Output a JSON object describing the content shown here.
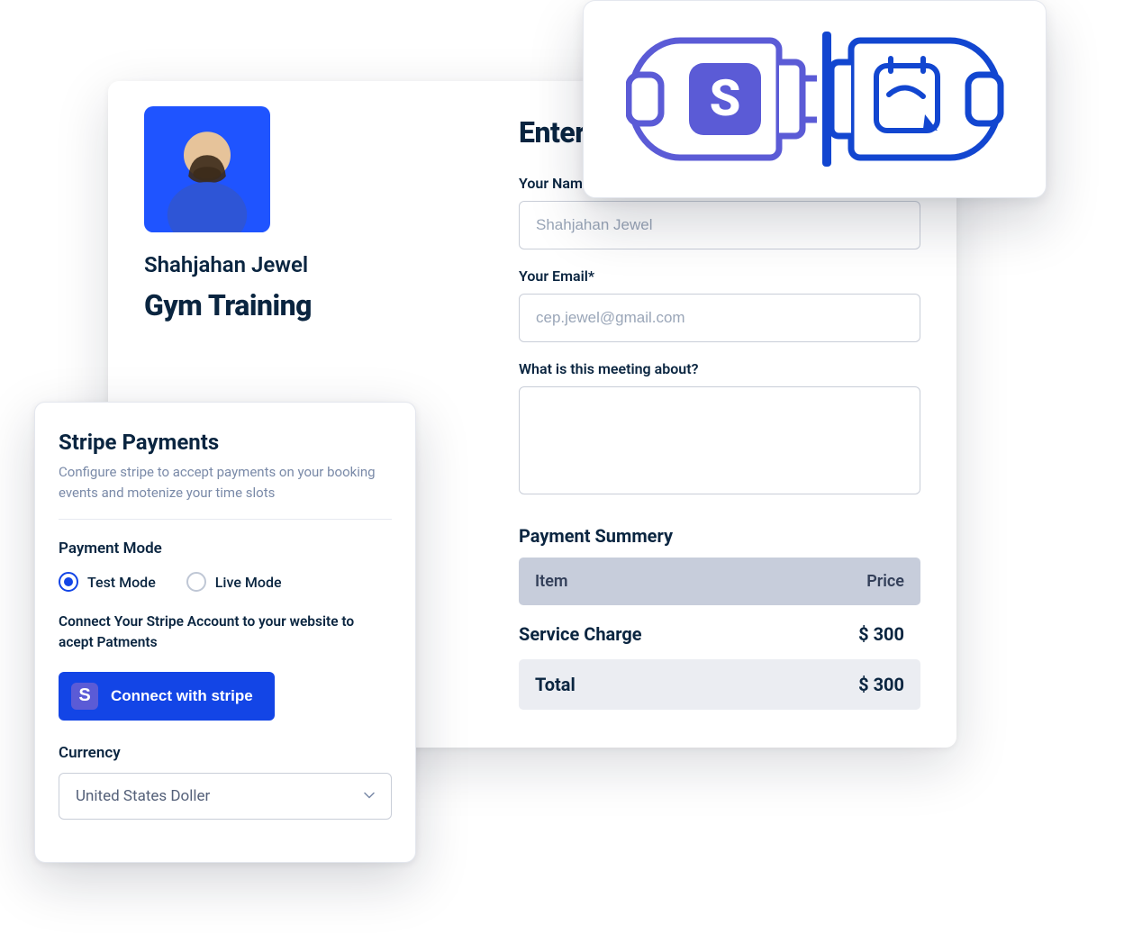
{
  "profile": {
    "name": "Shahjahan Jewel",
    "title": "Gym Training"
  },
  "form": {
    "heading": "Enter Details",
    "name": {
      "label": "Your Name*",
      "placeholder": "Shahjahan Jewel"
    },
    "email": {
      "label": "Your Email*",
      "placeholder": "cep.jewel@gmail.com"
    },
    "message": {
      "label": "What is this meeting about?"
    }
  },
  "summary": {
    "title": "Payment Summery",
    "col_item": "Item",
    "col_price": "Price",
    "line_label": "Service Charge",
    "line_price": "$ 300",
    "total_label": "Total",
    "total_price": "$ 300"
  },
  "stripe": {
    "title": "Stripe Payments",
    "desc": "Configure stripe to accept payments on your booking events and motenize your time slots",
    "mode_label": "Payment Mode",
    "test_label": "Test Mode",
    "live_label": "Live Mode",
    "selected_mode": "test",
    "connect_text": "Connect Your Stripe Account to your website to acept Patments",
    "connect_btn": "Connect with stripe",
    "currency_label": "Currency",
    "currency_value": "United States Doller"
  },
  "colors": {
    "accent": "#1345e6",
    "stripe": "#5b5bd6",
    "navy": "#0a2540"
  }
}
